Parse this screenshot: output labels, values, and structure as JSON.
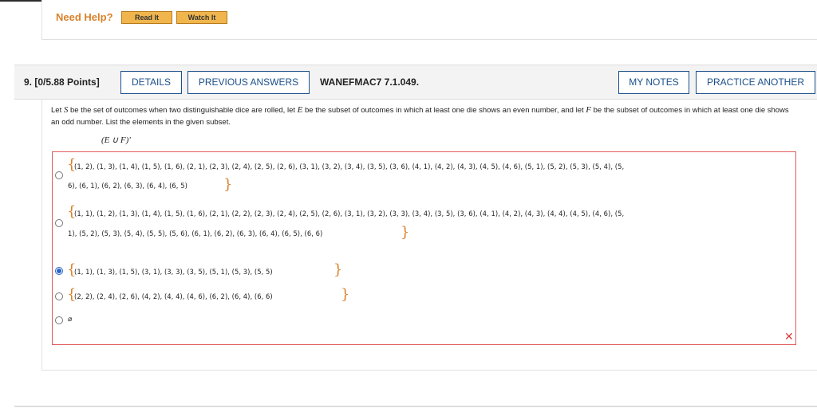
{
  "help": {
    "label": "Need Help?",
    "read_it": "Read It",
    "watch_it": "Watch It"
  },
  "question": {
    "number": "9. [0/5.88 Points]",
    "details": "DETAILS",
    "previous_answers": "PREVIOUS ANSWERS",
    "code": "WANEFMAC7 7.1.049.",
    "my_notes": "MY NOTES",
    "practice_another": "PRACTICE ANOTHER",
    "prompt": {
      "p1": "Let ",
      "S": "S",
      "p2": " be the set of outcomes when two distinguishable dice are rolled, let ",
      "E": "E",
      "p3": " be the subset of outcomes in which at least one die shows an even number, and let ",
      "F": "F",
      "p4": " be the subset of outcomes in which at least one die shows an odd number. List the elements in the given subset."
    },
    "subset": "(E ∪ F)'"
  },
  "options": [
    {
      "line1": "(1, 2), (1, 3), (1, 4), (1, 5), (1, 6), (2, 1), (2, 3), (2, 4), (2, 5), (2, 6), (3, 1), (3, 2), (3, 4), (3, 5), (3, 6), (4, 1), (4, 2), (4, 3), (4, 5), (4, 6), (5, 1), (5, 2), (5, 3), (5, 4), (5,",
      "line2": "6), (6, 1), (6, 2), (6, 3), (6, 4), (6, 5)",
      "selected": false
    },
    {
      "line1": "(1, 1), (1, 2), (1, 3), (1, 4), (1, 5), (1, 6), (2, 1), (2, 2), (2, 3), (2, 4), (2, 5), (2, 6), (3, 1), (3, 2), (3, 3), (3, 4), (3, 5), (3, 6), (4, 1), (4, 2), (4, 3), (4, 4), (4, 5), (4, 6), (5,",
      "line2": "1), (5, 2), (5, 3), (5, 4), (5, 5), (5, 6), (6, 1), (6, 2), (6, 3), (6, 4), (6, 5), (6, 6)",
      "selected": false
    },
    {
      "line1": "(1, 1), (1, 3), (1, 5), (3, 1), (3, 3), (3, 5), (5, 1), (5, 3), (5, 5)",
      "selected": true
    },
    {
      "line1": "(2, 2), (2, 4), (2, 6), (4, 2), (4, 4), (4, 6), (6, 2), (6, 4), (6, 6)",
      "selected": false
    },
    {
      "line1": "⌀",
      "selected": false
    }
  ],
  "braces": {
    "open": "{",
    "close": "}"
  },
  "status": {
    "wrong_icon": "✕",
    "wrong_color": "#d93b3b"
  },
  "colors": {
    "accent": "#1b4f8a",
    "help": "#d9822b",
    "error_border": "#e25a5a",
    "selected_radio": "#2a66c9"
  }
}
